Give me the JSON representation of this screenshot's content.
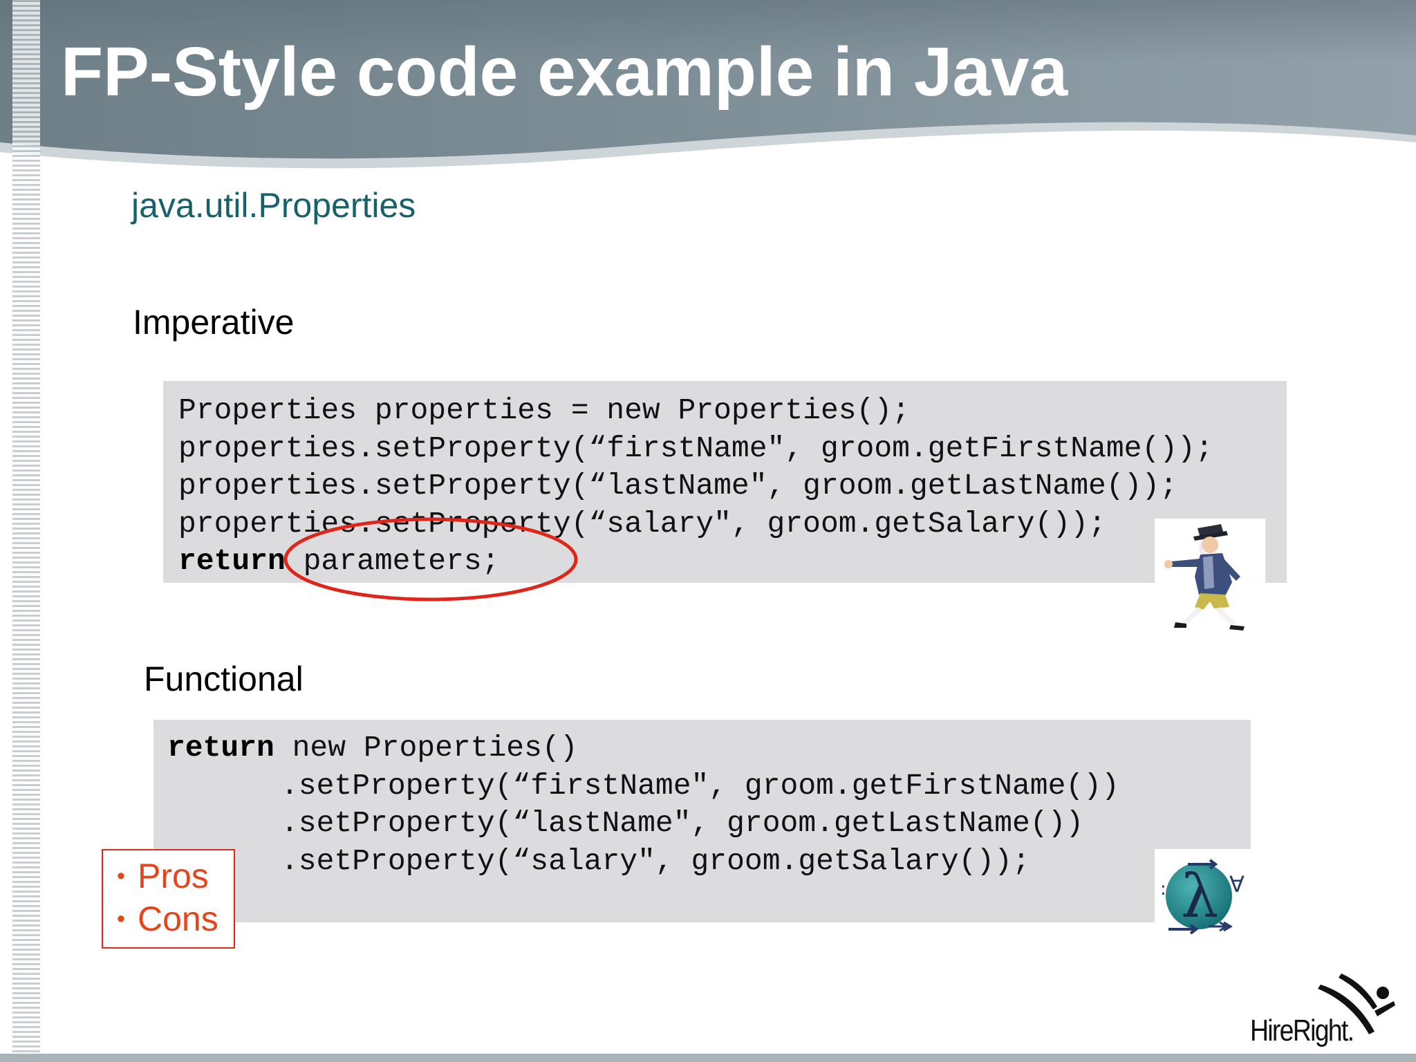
{
  "slide": {
    "title": "FP-Style code example in Java",
    "subtitle": "java.util.Properties"
  },
  "imperative": {
    "label": "Imperative",
    "lines": [
      "Properties properties = new Properties();",
      "properties.setProperty(“firstName\", groom.getFirstName());",
      "properties.setProperty(“lastName\", groom.getLastName());",
      "properties.setProperty(“salary\", groom.getSalary());",
      " parameters;"
    ],
    "return_keyword": "return"
  },
  "functional": {
    "label": "Functional",
    "return_keyword": "return",
    "first_line_rest": " new Properties()",
    "lines": [
      ".setProperty(“firstName\", groom.getFirstName())",
      ".setProperty(“lastName\", groom.getLastName())",
      ".setProperty(“salary\", groom.getSalary());"
    ]
  },
  "pros_cons": {
    "items": [
      "Pros",
      "Cons"
    ]
  },
  "logo": {
    "text": "HireRight."
  },
  "colors": {
    "header": "#7a8a93",
    "subtitle": "#17626a",
    "code_bg": "#dcdcde",
    "highlight": "#e0251b",
    "pros_cons_text": "#e8441a"
  },
  "icons": {
    "walker": "walking-man-illustration",
    "lambda": "lambda-logo-icon",
    "logo_mark": "running-figure-logo-mark"
  }
}
